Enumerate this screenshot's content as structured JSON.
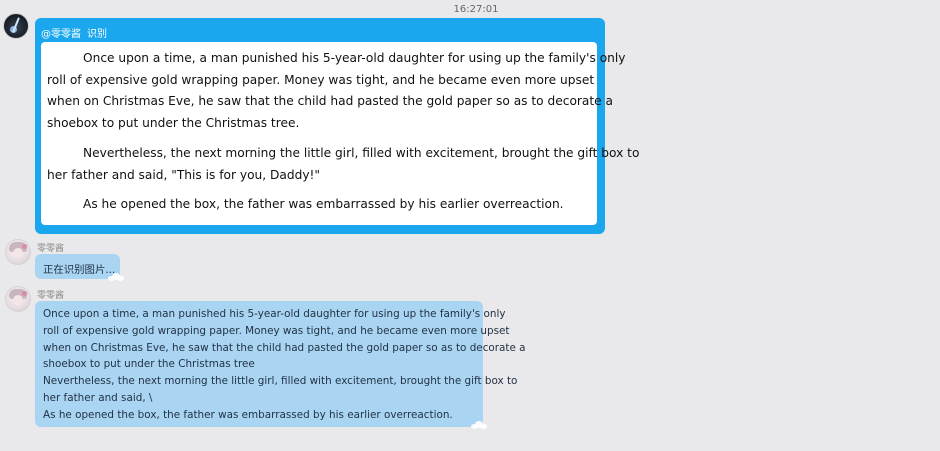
{
  "timestamp": "16:27:01",
  "card": {
    "mention": "@零零酱",
    "command": "识别",
    "paragraphs": [
      [
        "Once upon a time, a man punished his 5-year-old daughter for using up the family's only",
        "roll of expensive gold wrapping paper. Money was tight, and he became even more upset",
        "when on Christmas Eve, he saw that the child had pasted the gold paper so as to decorate a",
        "shoebox to put under the Christmas tree."
      ],
      [
        "Nevertheless, the next morning the little girl, filled with excitement, brought the gift box to",
        "her father and said, \"This is for you, Daddy!\""
      ],
      [
        "As he opened the box, the father was embarrassed by his earlier overreaction."
      ]
    ]
  },
  "messages": [
    {
      "sender": "零零酱",
      "text": "正在识别图片..."
    },
    {
      "sender": "零零酱",
      "lines": [
        "Once upon a time, a man punished his 5-year-old daughter for using up the family's only",
        "roll of expensive gold wrapping paper. Money was tight, and he became even more upset",
        "when on Christmas Eve, he saw that the child had pasted the gold paper so as to decorate a",
        "shoebox to put under the Christmas tree",
        "Nevertheless, the next morning the little girl, filled with excitement, brought the gift box to",
        "her father and said, \\",
        "As he opened the box, the father was embarrassed by his earlier overreaction."
      ]
    }
  ],
  "colors": {
    "background": "#e9e9eb",
    "card_blue": "#1aa7ee",
    "bubble_blue": "#a9d5f2"
  },
  "icons": {
    "user_avatar": "user-avatar-icon",
    "bot_avatar": "bot-avatar-icon",
    "bubble_decoration": "cloud-icon"
  }
}
